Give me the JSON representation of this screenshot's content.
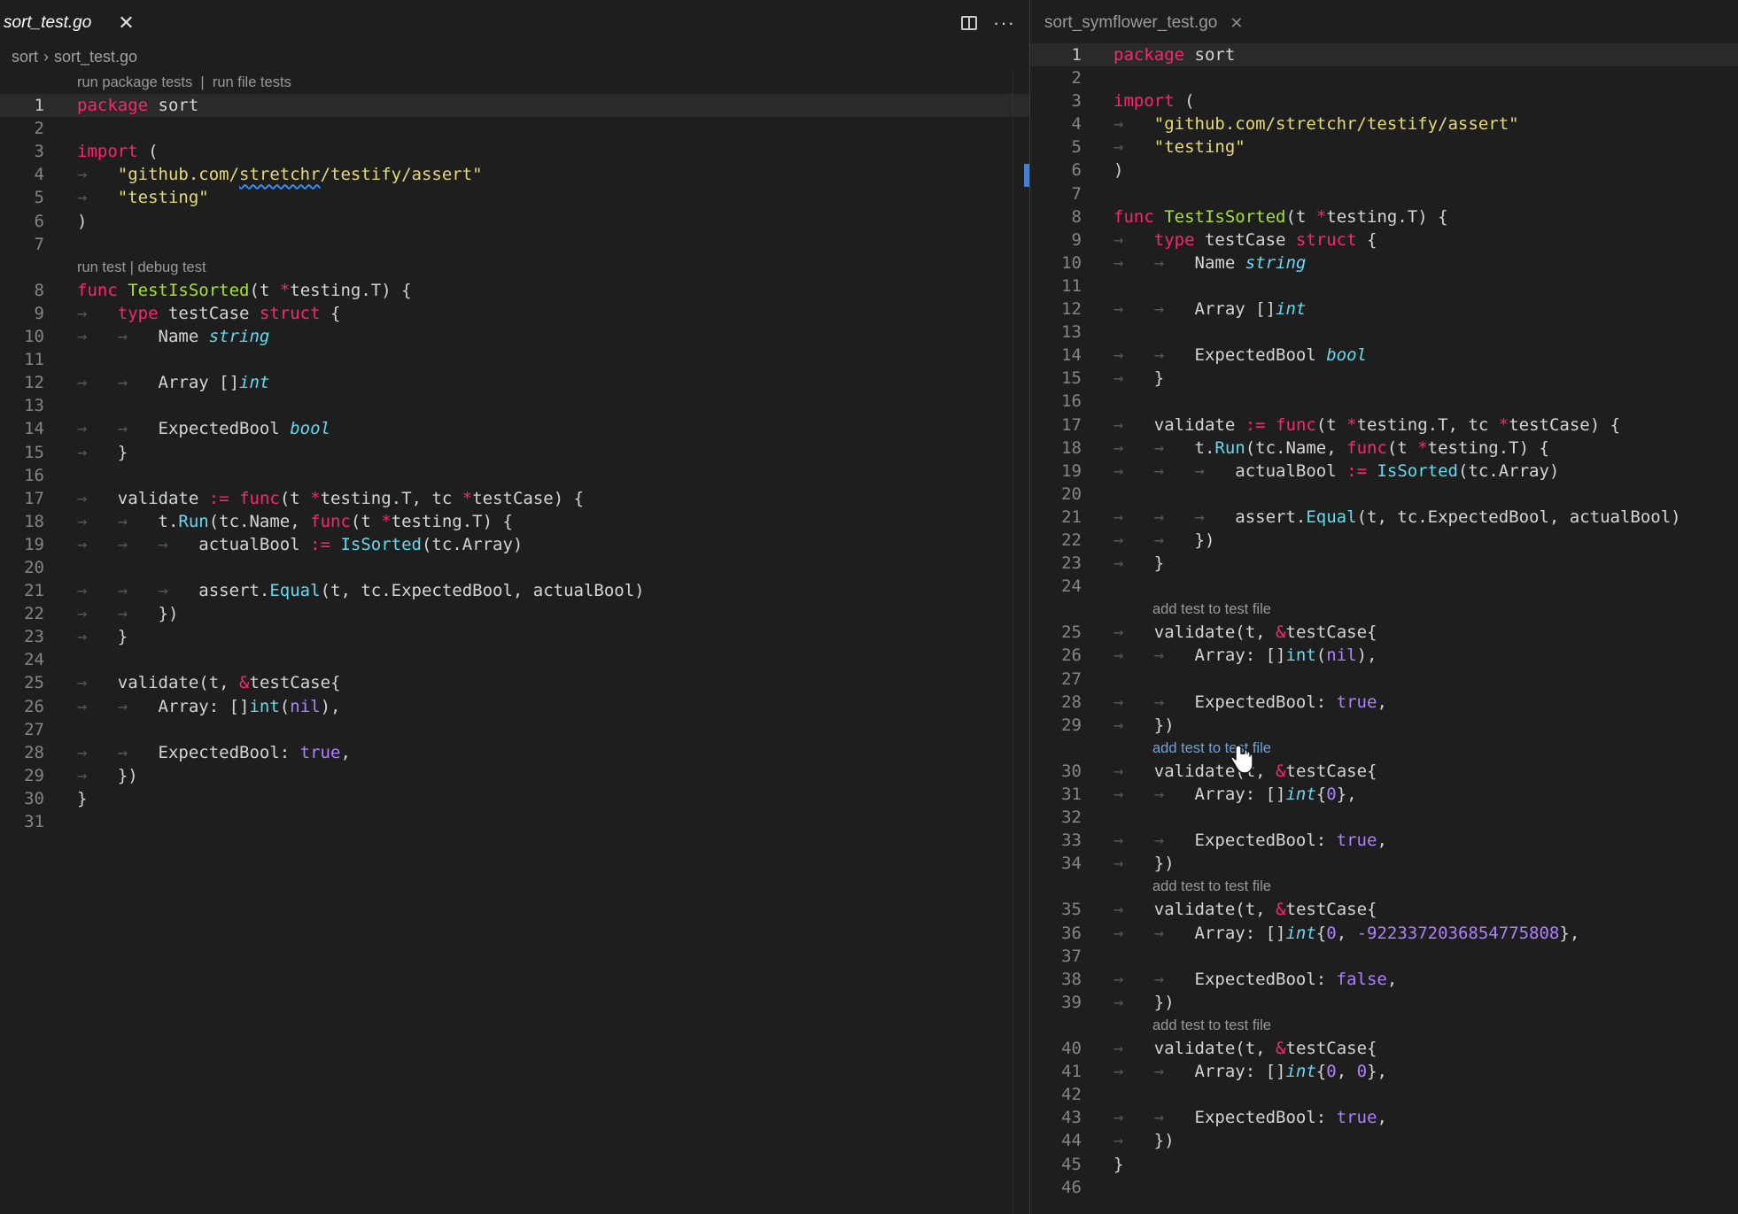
{
  "left": {
    "tab_label": "sort_test.go",
    "tab_close": "✕",
    "breadcrumb": {
      "folder": "sort",
      "separator": "›",
      "file": "sort_test.go"
    },
    "codelens_top": "run package tests  |  run file tests",
    "codelens_func": "run test | debug test"
  },
  "right": {
    "tab_label": "sort_symflower_test.go",
    "tab_close": "✕",
    "codelens_add": "add test to test file"
  },
  "icons": {
    "split": "split-editor-icon",
    "more": "more-actions-icon",
    "cursor": "hand-pointer-cursor-icon"
  },
  "colors": {
    "background": "#1e1e1e",
    "keyword": "#f92672",
    "function": "#a6e22e",
    "string": "#e6db74",
    "type": "#66d9ef",
    "number": "#ae81ff"
  }
}
